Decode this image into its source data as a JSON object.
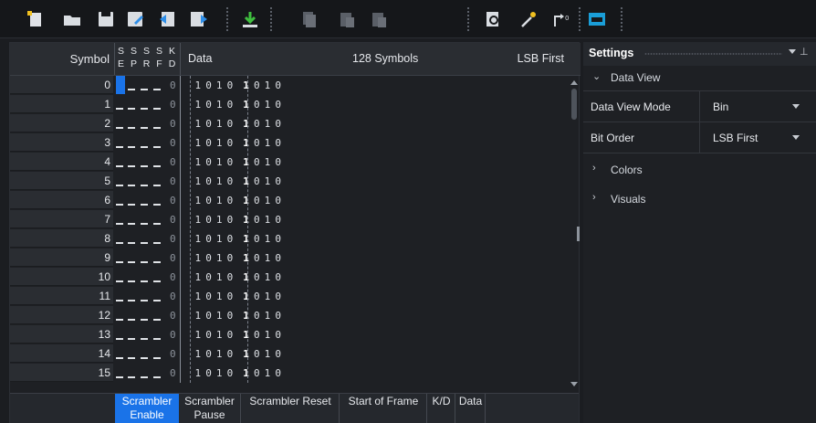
{
  "toolbar": {
    "buttons": [
      {
        "icon": "new-file-icon"
      },
      {
        "icon": "open-folder-icon"
      },
      {
        "icon": "save-icon"
      },
      {
        "icon": "save-as-icon"
      },
      {
        "icon": "import-icon"
      },
      {
        "icon": "export-icon"
      },
      {
        "icon": "download-icon"
      },
      {
        "icon": "copy-icon"
      },
      {
        "icon": "paste-icon"
      },
      {
        "icon": "paste-special-icon"
      },
      {
        "icon": "find-icon"
      },
      {
        "icon": "magic-icon"
      },
      {
        "icon": "shift-icon"
      },
      {
        "icon": "display-icon"
      }
    ]
  },
  "grid": {
    "header": {
      "symbol": "Symbol",
      "flags": [
        {
          "top": "S",
          "bottom": "E"
        },
        {
          "top": "S",
          "bottom": "P"
        },
        {
          "top": "S",
          "bottom": "R"
        },
        {
          "top": "S",
          "bottom": "F"
        },
        {
          "top": "K",
          "bottom": "D"
        }
      ],
      "data": "Data",
      "count": "128 Symbols",
      "bit_order": "LSB First"
    },
    "rows": [
      {
        "num": "0",
        "kd": "0",
        "bits": "1 0 1 0 1 0 1 0"
      },
      {
        "num": "1",
        "kd": "0",
        "bits": "1 0 1 0 1 0 1 0"
      },
      {
        "num": "2",
        "kd": "0",
        "bits": "1 0 1 0 1 0 1 0"
      },
      {
        "num": "3",
        "kd": "0",
        "bits": "1 0 1 0 1 0 1 0"
      },
      {
        "num": "4",
        "kd": "0",
        "bits": "1 0 1 0 1 0 1 0"
      },
      {
        "num": "5",
        "kd": "0",
        "bits": "1 0 1 0 1 0 1 0"
      },
      {
        "num": "6",
        "kd": "0",
        "bits": "1 0 1 0 1 0 1 0"
      },
      {
        "num": "7",
        "kd": "0",
        "bits": "1 0 1 0 1 0 1 0"
      },
      {
        "num": "8",
        "kd": "0",
        "bits": "1 0 1 0 1 0 1 0"
      },
      {
        "num": "9",
        "kd": "0",
        "bits": "1 0 1 0 1 0 1 0"
      },
      {
        "num": "10",
        "kd": "0",
        "bits": "1 0 1 0 1 0 1 0"
      },
      {
        "num": "11",
        "kd": "0",
        "bits": "1 0 1 0 1 0 1 0"
      },
      {
        "num": "12",
        "kd": "0",
        "bits": "1 0 1 0 1 0 1 0"
      },
      {
        "num": "13",
        "kd": "0",
        "bits": "1 0 1 0 1 0 1 0"
      },
      {
        "num": "14",
        "kd": "0",
        "bits": "1 0 1 0 1 0 1 0"
      },
      {
        "num": "15",
        "kd": "0",
        "bits": "1 0 1 0 1 0 1 0"
      }
    ],
    "legend": {
      "scrambler_enable": "Scrambler Enable",
      "scrambler_pause": "Scrambler Pause",
      "scrambler_reset": "Scrambler Reset",
      "start_of_frame": "Start of Frame",
      "kd": "K/D",
      "data": "Data"
    }
  },
  "settings": {
    "title": "Settings",
    "sections": {
      "data_view": "Data View",
      "colors": "Colors",
      "visuals": "Visuals"
    },
    "props": {
      "data_view_mode_label": "Data View Mode",
      "data_view_mode_value": "Bin",
      "bit_order_label": "Bit Order",
      "bit_order_value": "LSB First"
    }
  },
  "colors": {
    "accent": "#1a73e8",
    "background": "#1b1d21"
  }
}
